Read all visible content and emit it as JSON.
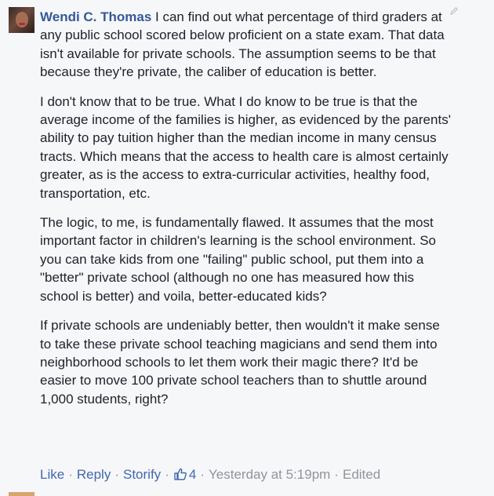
{
  "comment": {
    "author": "Wendi C. Thomas",
    "paragraphs": [
      " I can find out what percentage of third graders at any public school scored below proficient on a state exam. That data isn't available for private schools. The assumption seems to be that because they're private, the caliber of education is better.",
      "I don't know that to be true. What I do know to be true is that the average income of the families is higher, as evidenced by the parents' ability to pay tuition higher than the median income in many census tracts. Which means that the access to health care is almost certainly greater, as is the access to extra-curricular activities, healthy food, transportation, etc.",
      "The logic, to me, is fundamentally flawed. It assumes that the most important factor in children's learning is the school environment. So you can take kids from one \"failing\" public school, put them into a \"better\" private school (although no one has measured how this school is better) and voila, better-educated kids?",
      "If private schools are undeniably better, then wouldn't it make sense to take these private school teaching magicians and send them into neighborhood schools to let them work their magic there? It'd be easier to move 100 private school teachers than to shuttle around 1,000 students, right?"
    ],
    "actions": {
      "like": "Like",
      "reply": "Reply",
      "storify": "Storify",
      "like_count": "4",
      "timestamp": "Yesterday at 5:19pm",
      "edited": "Edited",
      "separator": "·"
    },
    "icons": {
      "edit": "pencil-icon",
      "reaction": "thumbs-up-icon"
    },
    "colors": {
      "link": "#365899",
      "action": "#4267b2",
      "meta": "#90949c",
      "background": "#f6f7f9"
    }
  }
}
